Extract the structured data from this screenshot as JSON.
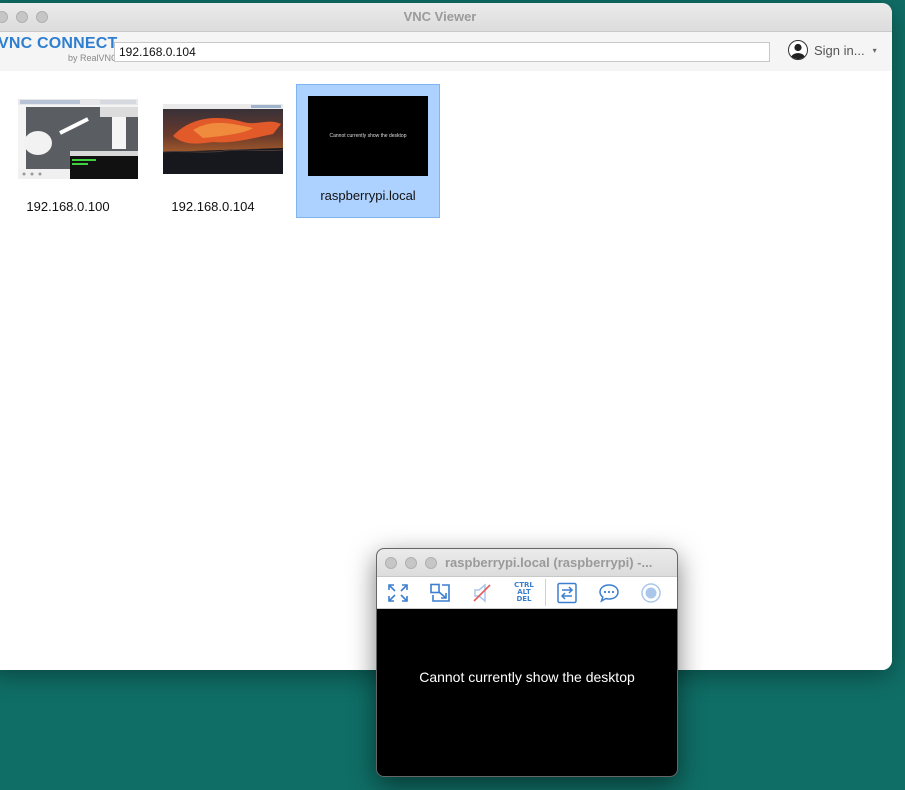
{
  "main_window": {
    "title": "VNC Viewer",
    "logo_main": "VNC CONNECT",
    "logo_sub": "by RealVNC",
    "address_value": "192.168.0.104",
    "sign_in_label": "Sign in...",
    "sign_in_caret": "▾"
  },
  "connections": [
    {
      "label": "192.168.0.100",
      "selected": false
    },
    {
      "label": "192.168.0.104",
      "selected": false
    },
    {
      "label": "raspberrypi.local",
      "selected": true,
      "thumb_text": "Cannot currently show the desktop"
    }
  ],
  "session_window": {
    "title": "raspberrypi.local (raspberrypi) -...",
    "message": "Cannot currently show the desktop",
    "toolbar": [
      {
        "name": "fullscreen-icon"
      },
      {
        "name": "scale-icon"
      },
      {
        "name": "audio-muted-icon"
      },
      {
        "name": "ctrl-alt-del-icon",
        "text": [
          "CTRL",
          "ALT",
          "DEL"
        ]
      },
      {
        "name": "file-transfer-icon"
      },
      {
        "name": "chat-icon"
      },
      {
        "name": "record-icon"
      }
    ]
  },
  "colors": {
    "desktop": "#0f6e66",
    "accent": "#2f7fd0",
    "selection": "#aed2ff"
  }
}
